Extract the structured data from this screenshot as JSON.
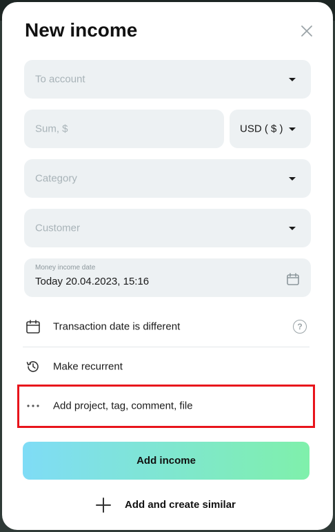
{
  "modal": {
    "title": "New income",
    "close_icon": "close-icon"
  },
  "fields": {
    "to_account": {
      "placeholder": "To account"
    },
    "sum": {
      "placeholder": "Sum,  $"
    },
    "currency": {
      "value": "USD ( $ )"
    },
    "category": {
      "placeholder": "Category"
    },
    "customer": {
      "placeholder": "Customer"
    },
    "income_date": {
      "label": "Money income date",
      "value": "Today 20.04.2023, 15:16"
    }
  },
  "rows": {
    "transaction_date": {
      "label": "Transaction date is different",
      "icon": "calendar-icon",
      "help_icon": "help-icon",
      "help_glyph": "?"
    },
    "recurrent": {
      "label": "Make recurrent",
      "icon": "history-icon"
    },
    "extras": {
      "label": "Add project, tag, comment, file",
      "icon": "more-dots-icon"
    }
  },
  "actions": {
    "primary_label": "Add income",
    "secondary_label": "Add and create similar"
  },
  "colors": {
    "highlight": "#e8141b",
    "gradient_start": "#7fdcf6",
    "gradient_end": "#7ff0ab",
    "field_bg": "#edf1f3"
  }
}
